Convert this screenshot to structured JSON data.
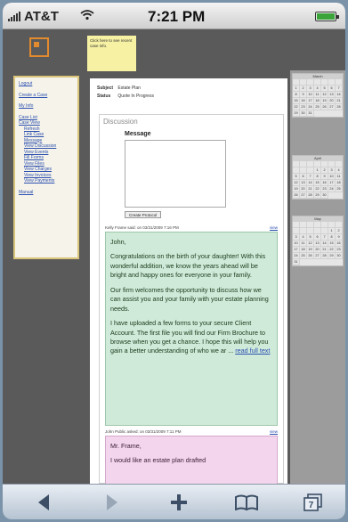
{
  "status_bar": {
    "carrier": "AT&T",
    "time": "7:21 PM"
  },
  "sticky_note": "Click here to see recent case info.",
  "menu": {
    "items": [
      "Logout",
      "Create a Case",
      "My Info"
    ],
    "case_list": "Case List",
    "case_view": "Case View",
    "sub_items": [
      "Refresh",
      "Link Case",
      "Message",
      "View Discussion",
      "View Events",
      "Fill Forms",
      "View Files",
      "View Charges",
      "View Invoices",
      "View Payments"
    ],
    "manual": "Manual"
  },
  "case": {
    "subject_label": "Subject",
    "subject_value": "Estate Plan",
    "status_label": "Status",
    "status_value": "Quote In Progress"
  },
  "discussion": {
    "title": "Discussion",
    "message_label": "Message",
    "create_button": "Create Protocol"
  },
  "posts": [
    {
      "header": "Kelly Frame said:   on 03/31/2009  7:16 PM",
      "view": "view",
      "greeting": "John,",
      "paragraphs": [
        "Congratulations on the birth of your daughter! With this wonderful addition, we know the years ahead will be bright and happy ones for everyone in your family.",
        "Our firm welcomes the opportunity to discuss how we can assist you and your family with your estate planning needs.",
        "I have uploaded a few forms to your secure Client Account. The first file you will find our Firm Brochure to browse when you get a chance. I hope this will help you gain a better understanding of who we ar ..."
      ],
      "read_more": "read full text"
    },
    {
      "header": "John Public asked:   on 03/31/2009  7:11 PM",
      "view": "view",
      "greeting": "Mr. Frame,",
      "paragraphs": [
        "I would like an estate plan drafted"
      ]
    }
  ],
  "calendars": [
    {
      "month": "March",
      "days": [
        "",
        "",
        "",
        "",
        "",
        "",
        "",
        "1",
        "2",
        "3",
        "4",
        "5",
        "6",
        "7",
        "8",
        "9",
        "10",
        "11",
        "12",
        "13",
        "14",
        "15",
        "16",
        "17",
        "18",
        "19",
        "20",
        "21",
        "22",
        "23",
        "24",
        "25",
        "26",
        "27",
        "28",
        "29",
        "30",
        "31"
      ]
    },
    {
      "month": "April",
      "days": [
        "",
        "",
        "",
        "",
        "",
        "",
        "",
        "",
        "",
        "",
        "1",
        "2",
        "3",
        "4",
        "5",
        "6",
        "7",
        "8",
        "9",
        "10",
        "11",
        "12",
        "13",
        "14",
        "15",
        "16",
        "17",
        "18",
        "19",
        "20",
        "21",
        "22",
        "23",
        "24",
        "25",
        "26",
        "27",
        "28",
        "29",
        "30"
      ]
    },
    {
      "month": "May",
      "days": [
        "",
        "",
        "",
        "",
        "",
        "",
        "",
        "",
        "",
        "",
        "",
        "",
        "1",
        "2",
        "3",
        "4",
        "5",
        "6",
        "7",
        "8",
        "9",
        "10",
        "11",
        "12",
        "13",
        "14",
        "15",
        "16",
        "17",
        "18",
        "19",
        "20",
        "21",
        "22",
        "23",
        "24",
        "25",
        "26",
        "27",
        "28",
        "29",
        "30",
        "31"
      ]
    }
  ],
  "toolbar": {
    "icons": [
      "back-icon",
      "forward-icon",
      "add-icon",
      "bookmarks-icon",
      "pages-icon"
    ],
    "pages_count": "7"
  },
  "colors": {
    "accent": "#e28a2e",
    "green_post": "#cfead9",
    "pink_post": "#f3d6ee"
  }
}
